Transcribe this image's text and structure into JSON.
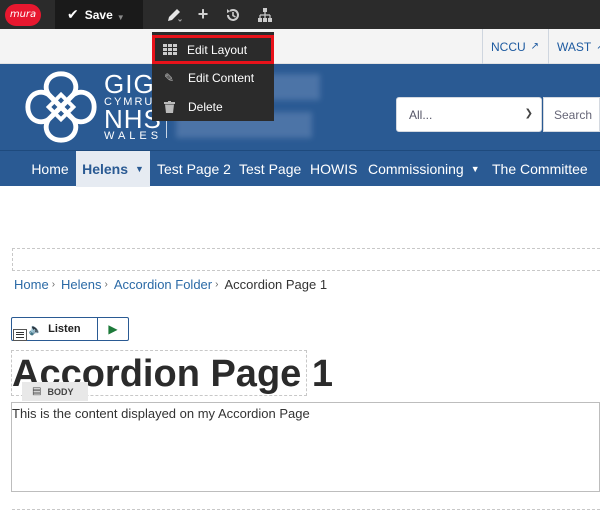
{
  "toolbar": {
    "logo_text": "mura",
    "save_label": "Save",
    "icons": [
      "pencil-icon",
      "plus-icon",
      "history-icon",
      "sitemap-icon"
    ]
  },
  "edit_menu": {
    "items": [
      {
        "label": "Edit Layout",
        "icon": "grid-icon",
        "highlighted": true
      },
      {
        "label": "Edit Content",
        "icon": "pencil-icon"
      },
      {
        "label": "Delete",
        "icon": "trash-icon"
      }
    ]
  },
  "top_links": [
    {
      "label": "NCCU",
      "icon": "external-link-icon"
    },
    {
      "label": "WAST",
      "icon": "external-link-icon"
    }
  ],
  "header": {
    "logo_line1": "GIG",
    "logo_line2": "CYMRU",
    "logo_line3": "NHS",
    "logo_line4": "WALES",
    "search_select": "All...",
    "search_placeholder": "Search"
  },
  "nav": {
    "items": [
      {
        "label": "Home"
      },
      {
        "label": "Helens",
        "active": true,
        "dropdown": true
      },
      {
        "label": "Test Page 2"
      },
      {
        "label": "Test Page"
      },
      {
        "label": "HOWIS"
      },
      {
        "label": "Commissioning",
        "dropdown": true
      },
      {
        "label": "The Committee"
      }
    ]
  },
  "breadcrumb": {
    "items": [
      "Home",
      "Helens",
      "Accordion Folder"
    ],
    "current": "Accordion Page 1"
  },
  "listen": {
    "label": "Listen"
  },
  "page": {
    "title": "Accordion Page 1",
    "body_tag": "BODY",
    "body_text": "This is the content displayed on my Accordion Page"
  },
  "colors": {
    "toolbar_bg": "#2b2b2b",
    "brand_blue": "#2a5a93",
    "highlight_red": "#e8121a",
    "mura_red": "#e8182f"
  }
}
